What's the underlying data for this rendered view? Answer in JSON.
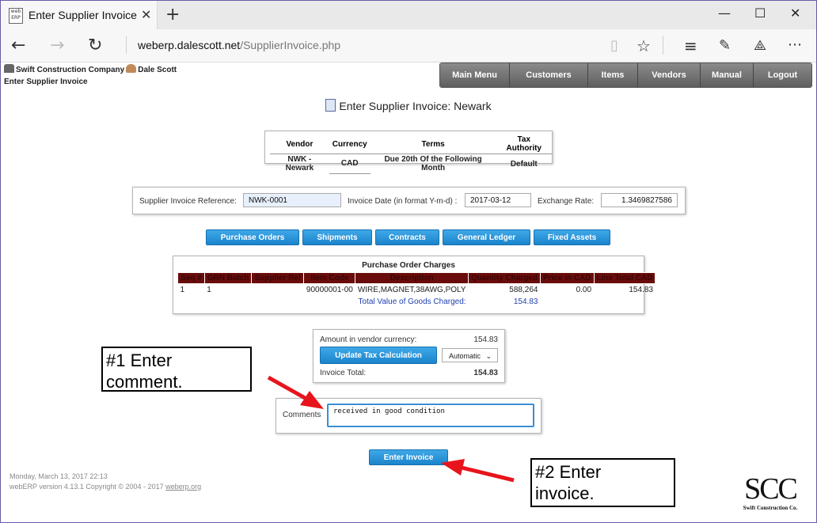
{
  "browser": {
    "tab_title": "Enter Supplier Invoice",
    "favicon_text": "web ERP",
    "url_domain": "weberp.dalescott.net",
    "url_path": "/SupplierInvoice.php"
  },
  "header": {
    "company": "Swift Construction Company",
    "user": "Dale Scott",
    "page_name": "Enter Supplier Invoice"
  },
  "menu": [
    "Main Menu",
    "Customers",
    "Items",
    "Vendors",
    "Manual",
    "Logout"
  ],
  "title": "Enter Supplier Invoice: Newark",
  "vendor_table": {
    "headers": [
      "Vendor",
      "Currency",
      "Terms",
      "Tax Authority"
    ],
    "row": [
      "NWK - Newark",
      "CAD",
      "Due 20th Of the Following Month",
      "Default"
    ]
  },
  "invoice": {
    "ref_label": "Supplier Invoice Reference:",
    "ref_value": "NWK-0001",
    "date_label": "Invoice Date (in format Y-m-d) :",
    "date_value": "2017-03-12",
    "rate_label": "Exchange Rate:",
    "rate_value": "1.3469827586"
  },
  "buttons": [
    "Purchase Orders",
    "Shipments",
    "Contracts",
    "General Ledger",
    "Fixed Assets"
  ],
  "po_charges": {
    "title": "Purchase Order Charges",
    "headers": [
      "Seq #",
      "GRN Batch",
      "Supplier Ref",
      "Item Code",
      "Description",
      "Quantity Charged",
      "Price in CAD",
      "Line Total CAD"
    ],
    "row": [
      "1",
      "1",
      "",
      "90000001-00",
      "WIRE,MAGNET,38AWG,POLY",
      "588,264",
      "0.00",
      "154.83"
    ],
    "total_label": "Total Value of Goods Charged:",
    "total_value": "154.83"
  },
  "amount": {
    "label": "Amount in vendor currency:",
    "value": "154.83",
    "update_button": "Update Tax Calculation",
    "tax_mode": "Automatic",
    "total_label": "Invoice Total:",
    "total_value": "154.83"
  },
  "comments": {
    "label": "Comments",
    "value": "received in good condition"
  },
  "enter_button": "Enter Invoice",
  "footer": {
    "datetime": "Monday, March 13, 2017 22:13",
    "version": "webERP version 4.13.1 Copyright © 2004 - 2017",
    "link": "weberp.org"
  },
  "callouts": {
    "one": [
      "#1 Enter",
      "comment."
    ],
    "two": [
      "#2 Enter",
      "invoice."
    ]
  },
  "logo": {
    "initials": "SCC",
    "name": "Swift Construction Co."
  },
  "colors": {
    "button_blue": "#2593db",
    "table_header": "#6a0c0c",
    "arrow_red": "#e8141c"
  }
}
